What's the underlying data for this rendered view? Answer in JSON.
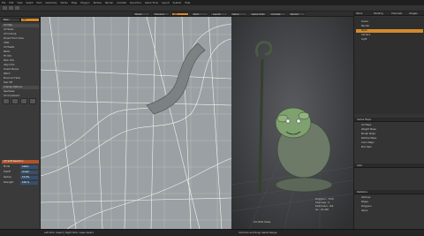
{
  "menu": [
    "File",
    "Edit",
    "View",
    "Select",
    "Item",
    "Geometry",
    "Vertex",
    "Edge",
    "Polygon",
    "Texture",
    "Render",
    "Animate",
    "Dynamics",
    "Game Tools",
    "Layout",
    "System",
    "Help"
  ],
  "layout_tabs": [
    {
      "label": "Model",
      "active": false
    },
    {
      "label": "Topology",
      "active": false
    },
    {
      "label": "UV",
      "active": true
    },
    {
      "label": "Paint",
      "active": false
    },
    {
      "label": "Layout",
      "active": false
    },
    {
      "label": "Setup",
      "active": false
    },
    {
      "label": "Game Tools",
      "active": false
    },
    {
      "label": "Animate",
      "active": false
    },
    {
      "label": "Render",
      "active": false
    }
  ],
  "left_panel": {
    "tab_a": "Basic",
    "tab_b": "UV",
    "items": [
      {
        "label": "UV Map",
        "style": "hdr"
      },
      {
        "label": "UV Relax",
        "style": ""
      },
      {
        "label": "UV Unwrap",
        "style": ""
      },
      {
        "label": "Project from View",
        "style": ""
      },
      {
        "label": "Atlas",
        "style": ""
      },
      {
        "label": "UV Peeler",
        "style": ""
      },
      {
        "label": "Relax",
        "style": ""
      },
      {
        "label": "Fit UVs",
        "style": ""
      },
      {
        "label": "Pack UVs",
        "style": ""
      },
      {
        "label": "Align UVs",
        "style": ""
      },
      {
        "label": "Orient Pieces",
        "style": ""
      },
      {
        "label": "Stitch",
        "style": ""
      },
      {
        "label": "Move and Sew",
        "style": ""
      },
      {
        "label": "Tear Off",
        "style": ""
      },
      {
        "label": "Unwrap Options",
        "style": "hdr"
      },
      {
        "label": "Seamless",
        "style": ""
      },
      {
        "label": "UV Constraint",
        "style": ""
      }
    ],
    "tool_properties_title": "UV Soft Selection",
    "properties": [
      {
        "label": "Mode",
        "value": "Lasso"
      },
      {
        "label": "Falloff",
        "value": "Linear"
      },
      {
        "label": "Radius",
        "value": "10.0%"
      },
      {
        "label": "Strength",
        "value": "100 %"
      }
    ]
  },
  "viewport_3d": {
    "label": "UV Edit View",
    "stats": [
      "Polygons : 7310",
      "Channels : 0",
      "Deformers : ON",
      "GL : 22,456"
    ]
  },
  "right_panel": {
    "tabs": [
      "Items",
      "Shading",
      "Channels",
      "Images"
    ],
    "scene_items": [
      {
        "label": "Scene",
        "hi": false
      },
      {
        "label": "Render",
        "hi": false
      },
      {
        "label": "Mesh",
        "hi": true
      },
      {
        "label": "Camera",
        "hi": false
      },
      {
        "label": "Light",
        "hi": false
      }
    ],
    "maps_title": "Vertex Maps",
    "maps": [
      "UV Maps",
      "Weight Maps",
      "Morph Maps",
      "Particle Maps",
      "Color Maps",
      "Pick Sets"
    ],
    "lists_title": "Lists",
    "stats_title": "Statistics",
    "stats": [
      "Vertices",
      "Edges",
      "Polygons",
      "Items"
    ]
  },
  "status": {
    "left": "Left Click: Select | Right Click: Lasso Select",
    "right": "Ctrl-Click and Drag: Select Range"
  },
  "colors": {
    "accent": "#d38a2a",
    "uv_bg": "#9aa0a3",
    "viewport": "#3b3c3e"
  }
}
